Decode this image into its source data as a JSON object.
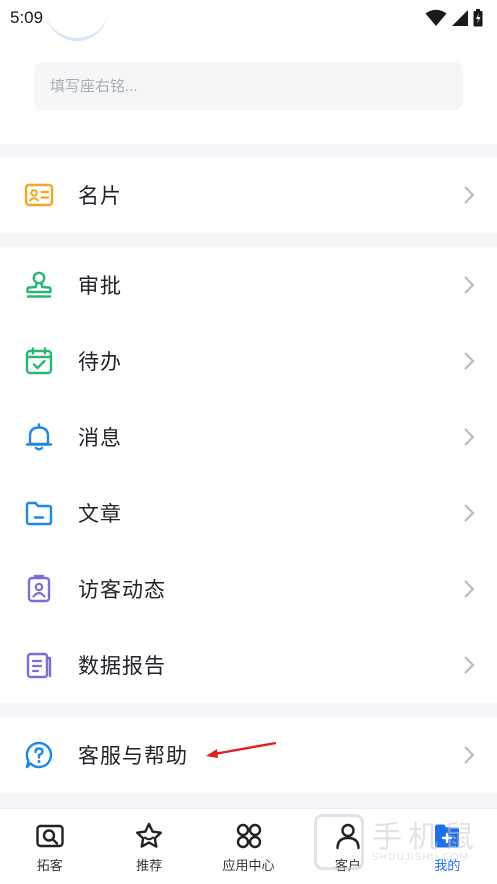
{
  "status_bar": {
    "time": "5:09"
  },
  "profile": {
    "motto_placeholder": "填写座右铭..."
  },
  "menu_groups": [
    {
      "items": [
        {
          "label": "名片",
          "icon": "business-card-icon"
        }
      ]
    },
    {
      "items": [
        {
          "label": "审批",
          "icon": "stamp-icon"
        },
        {
          "label": "待办",
          "icon": "calendar-check-icon"
        },
        {
          "label": "消息",
          "icon": "bell-icon"
        },
        {
          "label": "文章",
          "icon": "folder-icon"
        },
        {
          "label": "访客动态",
          "icon": "visitor-badge-icon"
        },
        {
          "label": "数据报告",
          "icon": "report-icon"
        }
      ]
    },
    {
      "items": [
        {
          "label": "客服与帮助",
          "icon": "help-chat-icon"
        }
      ]
    }
  ],
  "tab_bar": {
    "tabs": [
      {
        "label": "拓客",
        "icon": "search-card-icon"
      },
      {
        "label": "推荐",
        "icon": "star-icon"
      },
      {
        "label": "应用中心",
        "icon": "apps-grid-icon"
      },
      {
        "label": "客户",
        "icon": "person-icon"
      },
      {
        "label": "我的",
        "icon": "me-icon"
      }
    ],
    "active_index": 4
  },
  "watermark": {
    "text": "手机鼠",
    "sub": "SHOUJISHU.COM"
  },
  "colors": {
    "accent": "#1e6fe8",
    "card_orange": "#f5a623",
    "green": "#2bb673",
    "blue": "#1e88e5",
    "purple": "#7b6fd6",
    "annotation_red": "#e02020"
  }
}
